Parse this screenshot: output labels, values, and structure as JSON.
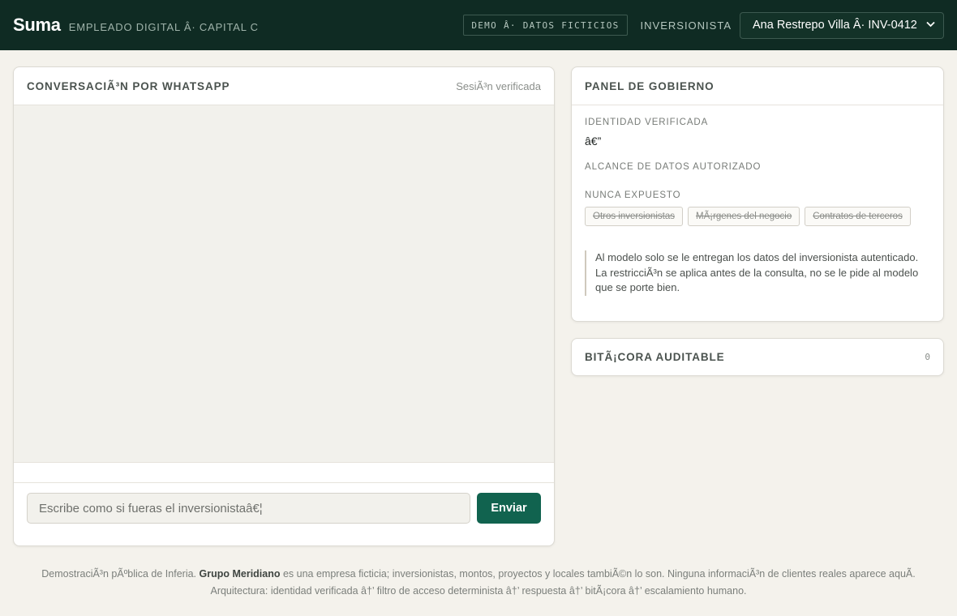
{
  "header": {
    "brand": "Suma",
    "subtitle": "EMPLEADO DIGITAL Â· CAPITAL C",
    "demo_badge": "DEMO Â· DATOS FICTICIOS",
    "investor_label": "INVERSIONISTA",
    "investor_selected": "Ana Restrepo Villa Â· INV-0412"
  },
  "chat": {
    "title": "CONVERSACIÃ³N POR WHATSAPP",
    "session_status": "SesiÃ³n verificada",
    "input_placeholder": "Escribe como si fueras el inversionistaâ€¦",
    "send_label": "Enviar"
  },
  "governance": {
    "title": "PANEL DE GOBIERNO",
    "identity_label": "IDENTIDAD VERIFICADA",
    "identity_value": "â€”",
    "scope_label": "ALCANCE DE DATOS AUTORIZADO",
    "never_label": "NUNCA EXPUESTO",
    "never_items": [
      "Otros inversionistas",
      "MÃ¡rgenes del negocio",
      "Contratos de terceros"
    ],
    "note": "Al modelo solo se le entregan los datos del inversionista autenticado. La restricciÃ³n se aplica antes de la consulta, no se le pide al modelo que se porte bien."
  },
  "audit": {
    "title": "BITÃ¡CORA AUDITABLE",
    "count": "0"
  },
  "footer": {
    "line1_pre": "DemostraciÃ³n pÃºblica de Inferia. ",
    "line1_bold": "Grupo Meridiano",
    "line1_post": " es una empresa ficticia; inversionistas, montos, proyectos y locales tambiÃ©n lo son. Ninguna informaciÃ³n de clientes reales aparece aquÃ.",
    "line2": "Arquitectura: identidad verificada â†’ filtro de acceso determinista â†’ respuesta â†’ bitÃ¡cora â†’ escalamiento humano."
  },
  "colors": {
    "header_bg": "#0f2b23",
    "accent": "#11634f",
    "page_bg": "#f4f2ec"
  }
}
